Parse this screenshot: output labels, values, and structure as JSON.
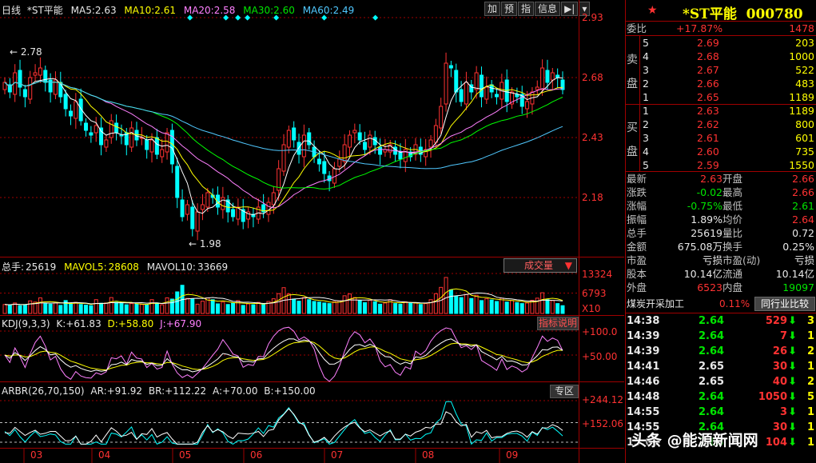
{
  "header": {
    "period": "日线",
    "stock": "*ST平能",
    "ma5_label": "MA5:",
    "ma5": "2.63",
    "ma10_label": "MA10:",
    "ma10": "2.61",
    "ma20_label": "MA20:",
    "ma20": "2.58",
    "ma30_label": "MA30:",
    "ma30": "2.60",
    "ma60_label": "MA60:",
    "ma60": "2.49",
    "toolbar": [
      "加",
      "预",
      "指",
      "信息"
    ]
  },
  "price_axis": [
    "2.93",
    "2.68",
    "2.43",
    "2.18"
  ],
  "annotations": {
    "high": "2.78",
    "low": "1.98"
  },
  "volume": {
    "label": "总手:",
    "value": "25619",
    "mavol5_label": "MAVOL5:",
    "mavol5": "28608",
    "mavol10_label": "MAVOL10:",
    "mavol10": "33669",
    "button": "成交量",
    "axis": [
      "13324",
      "6793",
      "X10"
    ]
  },
  "kdj": {
    "label": "KDJ(9,3,3)",
    "k_label": "K:",
    "k": "+61.83",
    "d_label": "D:",
    "d": "+58.80",
    "j_label": "J:",
    "j": "+67.90",
    "button": "指标说明",
    "axis": [
      "+100.0",
      "+50.00"
    ]
  },
  "arbr": {
    "label": "ARBR(26,70,150)",
    "ar_label": "AR:",
    "ar": "+91.92",
    "br_label": "BR:",
    "br": "+112.22",
    "a_label": "A:",
    "a": "+70.00",
    "b_label": "B:",
    "b": "+150.00",
    "button": "专区",
    "axis": [
      "+244.12",
      "+152.06"
    ]
  },
  "months": [
    "03",
    "04",
    "05",
    "06",
    "07",
    "08",
    "09"
  ],
  "quote": {
    "title": "*ST平能  000780",
    "weibi_label": "委比",
    "weibi": "+17.87%",
    "weicha": "1478",
    "sell_label": [
      "卖",
      "盘"
    ],
    "buy_label": [
      "买",
      "盘"
    ],
    "sell": [
      {
        "n": "5",
        "price": "2.69",
        "vol": "203"
      },
      {
        "n": "4",
        "price": "2.68",
        "vol": "1000"
      },
      {
        "n": "3",
        "price": "2.67",
        "vol": "522"
      },
      {
        "n": "2",
        "price": "2.66",
        "vol": "483"
      },
      {
        "n": "1",
        "price": "2.65",
        "vol": "1189"
      }
    ],
    "buy": [
      {
        "n": "1",
        "price": "2.63",
        "vol": "1189"
      },
      {
        "n": "2",
        "price": "2.62",
        "vol": "800"
      },
      {
        "n": "3",
        "price": "2.61",
        "vol": "601"
      },
      {
        "n": "4",
        "price": "2.60",
        "vol": "735"
      },
      {
        "n": "5",
        "price": "2.59",
        "vol": "1550"
      }
    ],
    "stats": [
      {
        "l1": "最新",
        "v1": "2.63",
        "c1": "red",
        "l2": "开盘",
        "v2": "2.66",
        "c2": "red"
      },
      {
        "l1": "涨跌",
        "v1": "-0.02",
        "c1": "grn",
        "l2": "最高",
        "v2": "2.66",
        "c2": "red"
      },
      {
        "l1": "涨幅",
        "v1": "-0.75%",
        "c1": "grn",
        "l2": "最低",
        "v2": "2.61",
        "c2": "grn"
      },
      {
        "l1": "振幅",
        "v1": "1.89%",
        "c1": "wht",
        "l2": "均价",
        "v2": "2.64",
        "c2": "red"
      },
      {
        "l1": "总手",
        "v1": "25619",
        "c1": "wht",
        "l2": "量比",
        "v2": "0.72",
        "c2": "wht"
      },
      {
        "l1": "金额",
        "v1": "675.08万",
        "c1": "wht",
        "l2": "换手",
        "v2": "0.25%",
        "c2": "wht"
      },
      {
        "l1": "市盈",
        "v1": "亏损",
        "c1": "wht",
        "l2": "市盈(动)",
        "v2": "亏损",
        "c2": "wht"
      },
      {
        "l1": "股本",
        "v1": "10.14亿",
        "c1": "wht",
        "l2": "流通",
        "v2": "10.14亿",
        "c2": "wht"
      },
      {
        "l1": "外盘",
        "v1": "6523",
        "c1": "red",
        "l2": "内盘",
        "v2": "19097",
        "c2": "grn"
      }
    ],
    "industry": "煤炭开采加工",
    "industry_change": "0.11%",
    "industry_button": "同行业比较",
    "ticks": [
      {
        "time": "14:38",
        "price": "2.64",
        "vol": "529",
        "dir": "down",
        "n": "3"
      },
      {
        "time": "14:39",
        "price": "2.64",
        "vol": "7",
        "dir": "down",
        "n": "1"
      },
      {
        "time": "14:39",
        "price": "2.64",
        "vol": "26",
        "dir": "down",
        "n": "2"
      },
      {
        "time": "14:41",
        "price": "2.65",
        "vol": "30",
        "dir": "down",
        "n": "1"
      },
      {
        "time": "14:46",
        "price": "2.65",
        "vol": "40",
        "dir": "down",
        "n": "2"
      },
      {
        "time": "14:48",
        "price": "2.64",
        "vol": "1050",
        "dir": "down",
        "n": "5"
      },
      {
        "time": "14:55",
        "price": "2.64",
        "vol": "3",
        "dir": "down",
        "n": "1"
      },
      {
        "time": "14:55",
        "price": "2.64",
        "vol": "30",
        "dir": "down",
        "n": "1"
      },
      {
        "time": "15:00",
        "price": "2.63",
        "vol": "104",
        "dir": "down",
        "n": "1"
      }
    ]
  },
  "watermark": "头条 @能源新闻网",
  "colors": {
    "up": "#ff3232",
    "down": "#00ffff",
    "grid": "#a00000",
    "ma5": "#ffffff",
    "ma10": "#ffff00",
    "ma20": "#ff80ff",
    "ma30": "#00ff00",
    "ma60": "#50c8ff"
  },
  "chart_data": {
    "type": "candlestick",
    "ylim": [
      1.95,
      2.95
    ],
    "close": [
      2.66,
      2.62,
      2.7,
      2.64,
      2.6,
      2.68,
      2.7,
      2.72,
      2.66,
      2.62,
      2.67,
      2.6,
      2.55,
      2.52,
      2.58,
      2.5,
      2.46,
      2.44,
      2.48,
      2.4,
      2.42,
      2.5,
      2.45,
      2.44,
      2.4,
      2.47,
      2.42,
      2.43,
      2.38,
      2.42,
      2.36,
      2.38,
      2.45,
      2.32,
      2.18,
      2.1,
      2.15,
      2.05,
      2.12,
      2.15,
      2.2,
      2.18,
      2.14,
      2.18,
      2.12,
      2.1,
      2.14,
      2.08,
      2.12,
      2.1,
      2.14,
      2.12,
      2.16,
      2.2,
      2.3,
      2.4,
      2.46,
      2.42,
      2.36,
      2.44,
      2.4,
      2.35,
      2.32,
      2.28,
      2.25,
      2.3,
      2.34,
      2.4,
      2.44,
      2.46,
      2.42,
      2.38,
      2.44,
      2.4,
      2.36,
      2.38,
      2.4,
      2.36,
      2.34,
      2.38,
      2.35,
      2.4,
      2.36,
      2.38,
      2.42,
      2.48,
      2.56,
      2.74,
      2.72,
      2.62,
      2.58,
      2.66,
      2.62,
      2.7,
      2.6,
      2.64,
      2.62,
      2.6,
      2.66,
      2.58,
      2.62,
      2.6,
      2.56,
      2.58,
      2.62,
      2.64,
      2.72,
      2.66,
      2.7,
      2.68,
      2.63
    ],
    "volume": [
      3000,
      2800,
      3500,
      2600,
      2900,
      4200,
      3800,
      5200,
      3300,
      3100,
      3500,
      2700,
      4300,
      3100,
      3700,
      3000,
      2800,
      2600,
      4600,
      3400,
      3500,
      5300,
      3700,
      3300,
      2900,
      3300,
      3100,
      3000,
      2800,
      4600,
      3500,
      2900,
      5200,
      4800,
      7200,
      9400,
      5000,
      4800,
      3100,
      4100,
      5200,
      4600,
      3200,
      3800,
      3000,
      3400,
      4300,
      2700,
      3200,
      2900,
      3700,
      3100,
      4000,
      4900,
      6600,
      8600,
      6500,
      4800,
      4100,
      5300,
      4600,
      4000,
      3800,
      3500,
      3300,
      3900,
      4200,
      5900,
      6500,
      5300,
      4400,
      3600,
      4400,
      3900,
      3100,
      3500,
      4600,
      3300,
      3100,
      3900,
      3400,
      3600,
      3000,
      3300,
      4600,
      6600,
      8700,
      12000,
      7900,
      5800,
      5300,
      6300,
      5000,
      6100,
      4300,
      4900,
      4500,
      4000,
      5100,
      3800,
      4300,
      3600,
      3300,
      3500,
      4400,
      5100,
      6900,
      4600,
      4300,
      3300,
      2600
    ]
  }
}
